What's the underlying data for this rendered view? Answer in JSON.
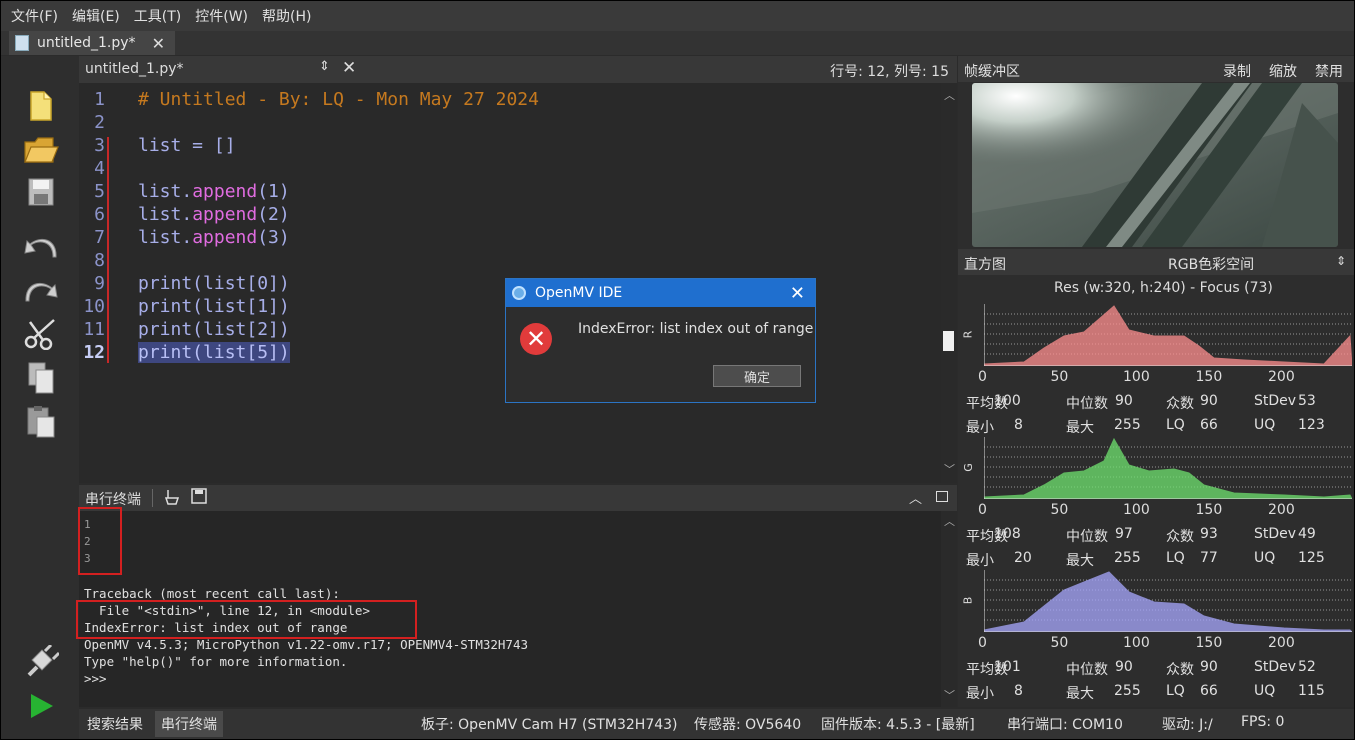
{
  "menu": [
    "文件(F)",
    "编辑(E)",
    "工具(T)",
    "控件(W)",
    "帮助(H)"
  ],
  "file_tab": {
    "label": "untitled_1.py*"
  },
  "editor_header": {
    "filename": "untitled_1.py*",
    "position": "行号: 12, 列号: 15"
  },
  "editor": {
    "line_numbers": [
      "1",
      "2",
      "3",
      "4",
      "5",
      "6",
      "7",
      "8",
      "9",
      "10",
      "11",
      "12"
    ],
    "lines": {
      "l1": "# Untitled - By: LQ - Mon May 27 2024",
      "l3": "list = []",
      "l5a": "list.",
      "l5b": "append",
      "l5c": "(1)",
      "l6a": "list.",
      "l6b": "append",
      "l6c": "(2)",
      "l7a": "list.",
      "l7b": "append",
      "l7c": "(3)",
      "l9": "print(list[0])",
      "l10": "print(list[1])",
      "l11": "print(list[2])",
      "l12": "print(list[5])"
    }
  },
  "dialog": {
    "title": "OpenMV IDE",
    "message": "IndexError: list index out of range",
    "ok": "确定"
  },
  "terminal": {
    "header": "串行终端",
    "lines": {
      "o1": "1",
      "o2": "2",
      "o3": "3",
      "t1": "Traceback (most recent call last):",
      "t2": "  File \"<stdin>\", line 12, in <module>",
      "t3": "IndexError: list index out of range",
      "t4": "OpenMV v4.5.3; MicroPython v1.22-omv.r17; OPENMV4-STM32H743",
      "t5": "Type \"help()\" for more information.",
      "t6": ">>>"
    }
  },
  "statusbar": {
    "tab_search": "搜索结果",
    "tab_serial": "串行终端",
    "board": "板子: OpenMV Cam H7 (STM32H743)",
    "sensor": "传感器: OV5640",
    "firmware": "固件版本: 4.5.3 - [最新]",
    "port": "串行端口: COM10",
    "drive": "驱动: J:/",
    "fps": "FPS: 0"
  },
  "right_panel": {
    "framebuffer": {
      "title": "帧缓冲区",
      "record": "录制",
      "zoom": "缩放",
      "disable": "禁用"
    },
    "histogram": {
      "title": "直方图",
      "colorspace": "RGB色彩空间",
      "info": "Res (w:320, h:240) - Focus (73)"
    },
    "axis_ticks": [
      "0",
      "50",
      "100",
      "150",
      "200"
    ],
    "channels": [
      {
        "label": "R",
        "color": "#ff8f8f",
        "mean_label": "平均数",
        "mean": "100",
        "median_label": "中位数",
        "median": "90",
        "mode_label": "众数",
        "mode": "90",
        "stdev_label": "StDev",
        "stdev": "53",
        "min_label": "最小",
        "min": "8",
        "max_label": "最大",
        "max": "255",
        "lq_label": "LQ",
        "lq": "66",
        "uq_label": "UQ",
        "uq": "123"
      },
      {
        "label": "G",
        "color": "#6fe36f",
        "mean_label": "平均数",
        "mean": "108",
        "median_label": "中位数",
        "median": "97",
        "mode_label": "众数",
        "mode": "93",
        "stdev_label": "StDev",
        "stdev": "49",
        "min_label": "最小",
        "min": "20",
        "max_label": "最大",
        "max": "255",
        "lq_label": "LQ",
        "lq": "77",
        "uq_label": "UQ",
        "uq": "125"
      },
      {
        "label": "B",
        "color": "#a8a8ff",
        "mean_label": "平均数",
        "mean": "101",
        "median_label": "中位数",
        "median": "90",
        "mode_label": "众数",
        "mode": "90",
        "stdev_label": "StDev",
        "stdev": "52",
        "min_label": "最小",
        "min": "8",
        "max_label": "最大",
        "max": "255",
        "lq_label": "LQ",
        "lq": "66",
        "uq_label": "UQ",
        "uq": "115"
      }
    ]
  }
}
